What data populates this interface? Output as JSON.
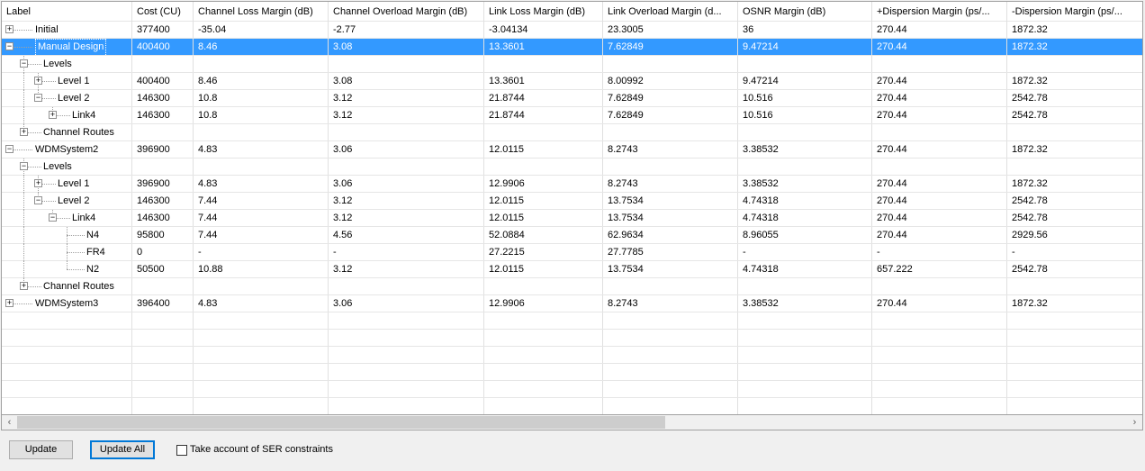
{
  "columns": [
    "Label",
    "Cost (CU)",
    "Channel Loss Margin (dB)",
    "Channel Overload Margin (dB)",
    "Link Loss Margin (dB)",
    "Link Overload Margin (d...",
    "OSNR Margin (dB)",
    "+Dispersion Margin (ps/...",
    "-Dispersion Margin (ps/..."
  ],
  "rows": [
    {
      "label": "Initial",
      "level": 0,
      "expander": "+",
      "values": [
        "377400",
        "-35.04",
        "-2.77",
        "-3.04134",
        "23.3005",
        "36",
        "270.44",
        "1872.32"
      ]
    },
    {
      "label": "Manual Design",
      "level": 0,
      "expander": "-",
      "selected": true,
      "values": [
        "400400",
        "8.46",
        "3.08",
        "13.3601",
        "7.62849",
        "9.47214",
        "270.44",
        "1872.32"
      ]
    },
    {
      "label": "Levels",
      "level": 1,
      "expander": "-",
      "values": [
        "",
        "",
        "",
        "",
        "",
        "",
        "",
        ""
      ]
    },
    {
      "label": "Level 1",
      "level": 2,
      "expander": "+",
      "values": [
        "400400",
        "8.46",
        "3.08",
        "13.3601",
        "8.00992",
        "9.47214",
        "270.44",
        "1872.32"
      ]
    },
    {
      "label": "Level 2",
      "level": 2,
      "expander": "-",
      "values": [
        "146300",
        "10.8",
        "3.12",
        "21.8744",
        "7.62849",
        "10.516",
        "270.44",
        "2542.78"
      ]
    },
    {
      "label": "Link4",
      "level": 3,
      "expander": "+",
      "values": [
        "146300",
        "10.8",
        "3.12",
        "21.8744",
        "7.62849",
        "10.516",
        "270.44",
        "2542.78"
      ]
    },
    {
      "label": "Channel Routes",
      "level": 1,
      "expander": "+",
      "values": [
        "",
        "",
        "",
        "",
        "",
        "",
        "",
        ""
      ]
    },
    {
      "label": "WDMSystem2",
      "level": 0,
      "expander": "-",
      "values": [
        "396900",
        "4.83",
        "3.06",
        "12.0115",
        "8.2743",
        "3.38532",
        "270.44",
        "1872.32"
      ]
    },
    {
      "label": "Levels",
      "level": 1,
      "expander": "-",
      "values": [
        "",
        "",
        "",
        "",
        "",
        "",
        "",
        ""
      ]
    },
    {
      "label": "Level 1",
      "level": 2,
      "expander": "+",
      "values": [
        "396900",
        "4.83",
        "3.06",
        "12.9906",
        "8.2743",
        "3.38532",
        "270.44",
        "1872.32"
      ]
    },
    {
      "label": "Level 2",
      "level": 2,
      "expander": "-",
      "values": [
        "146300",
        "7.44",
        "3.12",
        "12.0115",
        "13.7534",
        "4.74318",
        "270.44",
        "2542.78"
      ]
    },
    {
      "label": "Link4",
      "level": 3,
      "expander": "-",
      "values": [
        "146300",
        "7.44",
        "3.12",
        "12.0115",
        "13.7534",
        "4.74318",
        "270.44",
        "2542.78"
      ]
    },
    {
      "label": "N4",
      "level": 4,
      "expander": "",
      "values": [
        "95800",
        "7.44",
        "4.56",
        "52.0884",
        "62.9634",
        "8.96055",
        "270.44",
        "2929.56"
      ]
    },
    {
      "label": "FR4",
      "level": 4,
      "expander": "",
      "values": [
        "0",
        "-",
        "-",
        "27.2215",
        "27.7785",
        "-",
        "-",
        "-"
      ]
    },
    {
      "label": "N2",
      "level": 4,
      "expander": "",
      "values": [
        "50500",
        "10.88",
        "3.12",
        "12.0115",
        "13.7534",
        "4.74318",
        "657.222",
        "2542.78"
      ]
    },
    {
      "label": "Channel Routes",
      "level": 1,
      "expander": "+",
      "values": [
        "",
        "",
        "",
        "",
        "",
        "",
        "",
        ""
      ]
    },
    {
      "label": "WDMSystem3",
      "level": 0,
      "expander": "+",
      "values": [
        "396400",
        "4.83",
        "3.06",
        "12.9906",
        "8.2743",
        "3.38532",
        "270.44",
        "1872.32"
      ]
    }
  ],
  "buttons": {
    "update": "Update",
    "update_all": "Update All"
  },
  "checkbox": {
    "label": "Take account of SER constraints",
    "checked": false
  },
  "icons": {
    "scroll_left": "scroll-left-icon",
    "scroll_right": "scroll-right-icon"
  }
}
